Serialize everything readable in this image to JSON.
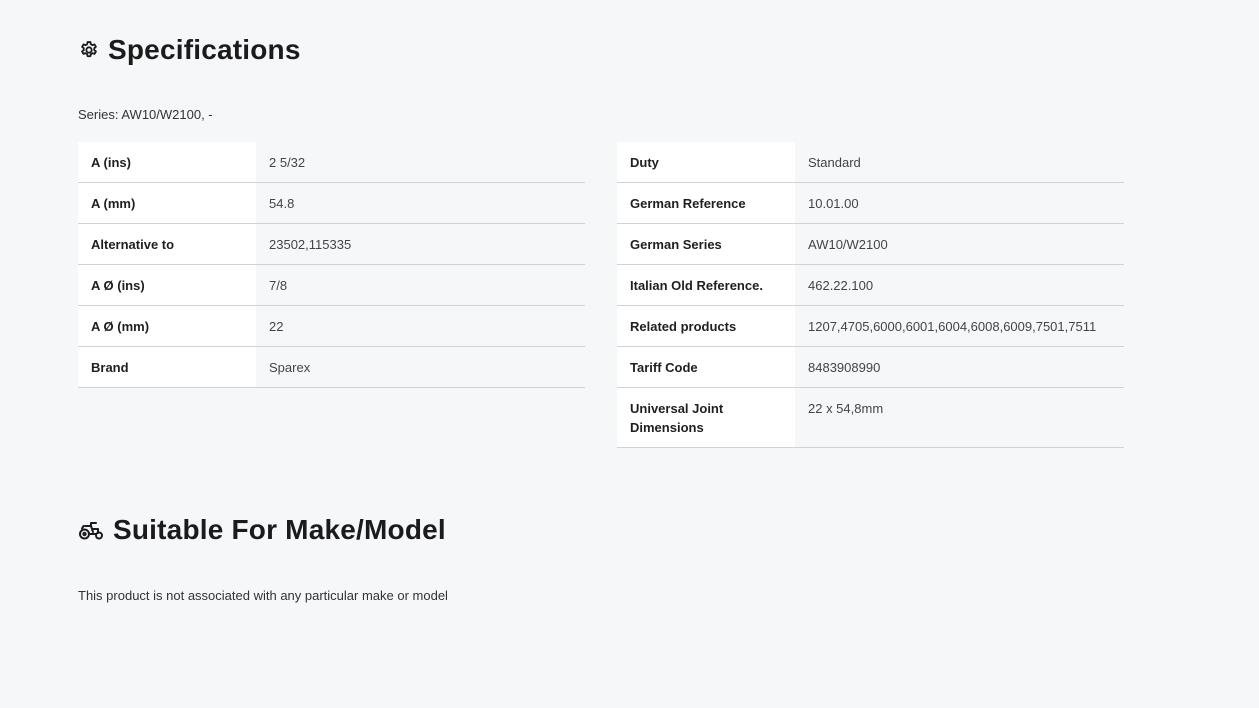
{
  "specifications": {
    "heading": "Specifications",
    "icon": "gear-icon",
    "series_text": "Series: AW10/W2100, -",
    "left_rows": [
      {
        "label": "A (ins)",
        "value": "2 5/32"
      },
      {
        "label": "A (mm)",
        "value": "54.8"
      },
      {
        "label": "Alternative to",
        "value": "23502,115335"
      },
      {
        "label": "A Ø (ins)",
        "value": "7/8"
      },
      {
        "label": "A Ø (mm)",
        "value": "22"
      },
      {
        "label": "Brand",
        "value": "Sparex"
      }
    ],
    "right_rows": [
      {
        "label": "Duty",
        "value": "Standard"
      },
      {
        "label": "German Reference",
        "value": "10.01.00"
      },
      {
        "label": "German Series",
        "value": "AW10/W2100"
      },
      {
        "label": "Italian Old Reference.",
        "value": "462.22.100"
      },
      {
        "label": "Related products",
        "value": "1207,4705,6000,6001,6004,6008,6009,7501,7511"
      },
      {
        "label": "Tariff Code",
        "value": "8483908990"
      },
      {
        "label": "Universal Joint Dimensions",
        "value": "22 x 54,8mm"
      }
    ]
  },
  "suitable": {
    "heading": "Suitable For Make/Model",
    "icon": "tractor-icon",
    "text": "This product is not associated with any particular make or model"
  },
  "colors": {
    "background": "#f6f7f9",
    "label_cell": "#ffffff",
    "row_border": "#cfd2d6"
  }
}
